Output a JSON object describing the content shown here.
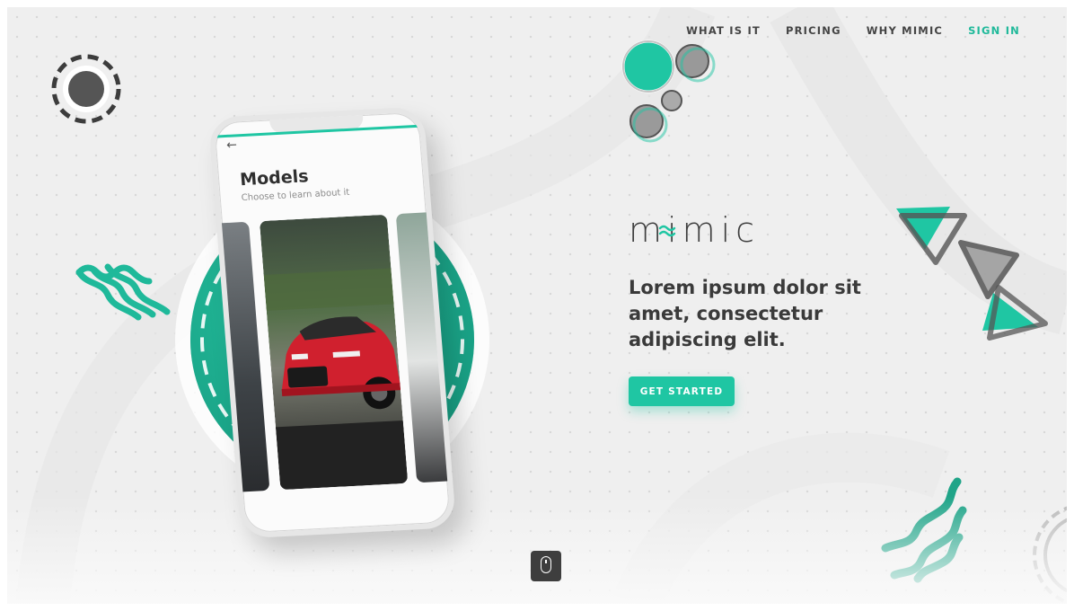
{
  "nav": {
    "items": [
      {
        "label": "WHAT IS IT"
      },
      {
        "label": "PRICING"
      },
      {
        "label": "WHY MIMIC"
      },
      {
        "label": "SIGN IN"
      }
    ]
  },
  "brand": {
    "logo_text": "mimic"
  },
  "hero": {
    "headline": "Lorem ipsum dolor sit amet, consectetur adipiscing elit.",
    "cta_label": "GET STARTED"
  },
  "phone_screen": {
    "title": "Models",
    "subtitle": "Choose to learn about it",
    "back_icon": "arrow-left-icon"
  },
  "icons": {
    "scroll": "mouse-scroll-icon"
  },
  "colors": {
    "accent": "#1fc6a3",
    "text_dark": "#3a3a3a",
    "nav_accent": "#1fb99a",
    "background": "#efefef",
    "car_red": "#d0202e"
  }
}
